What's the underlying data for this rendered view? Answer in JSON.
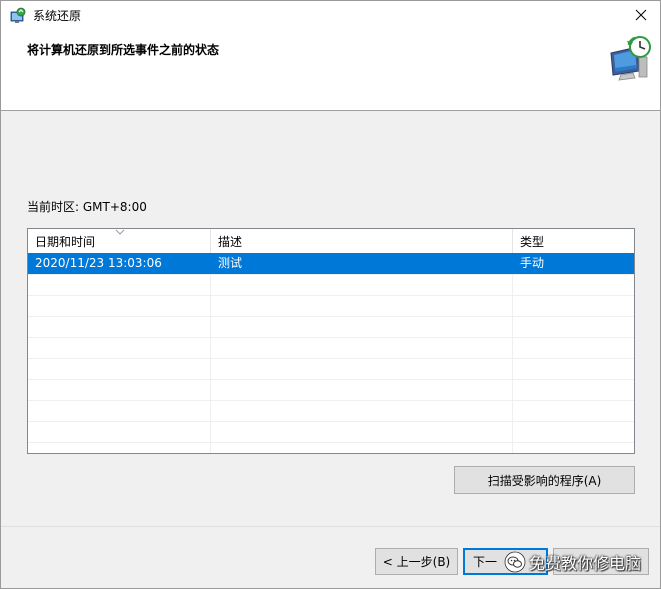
{
  "window": {
    "title": "系统还原",
    "heading": "将计算机还原到所选事件之前的状态",
    "icons": {
      "title": "system-restore-icon",
      "wizard": "monitor-restore-icon",
      "close": "close-icon"
    }
  },
  "timezone": {
    "label": "当前时区: ",
    "value": "GMT+8:00"
  },
  "table": {
    "columns": [
      "日期和时间",
      "描述",
      "类型"
    ],
    "sort_column": "日期和时间",
    "rows": [
      {
        "datetime": "2020/11/23 13:03:06",
        "description": "测试",
        "type": "手动",
        "selected": true
      }
    ]
  },
  "buttons": {
    "scan": "扫描受影响的程序(A)",
    "back": "< 上一步(B)",
    "next": "下一步(N) >",
    "next_visible": "下一",
    "cancel": "取消"
  },
  "watermark": {
    "text": "免费教你修电脑",
    "icon": "wechat-icon"
  },
  "colors": {
    "selection": "#0078d7",
    "header_bg": "#ffffff",
    "dialog_bg": "#f0f0f0"
  }
}
